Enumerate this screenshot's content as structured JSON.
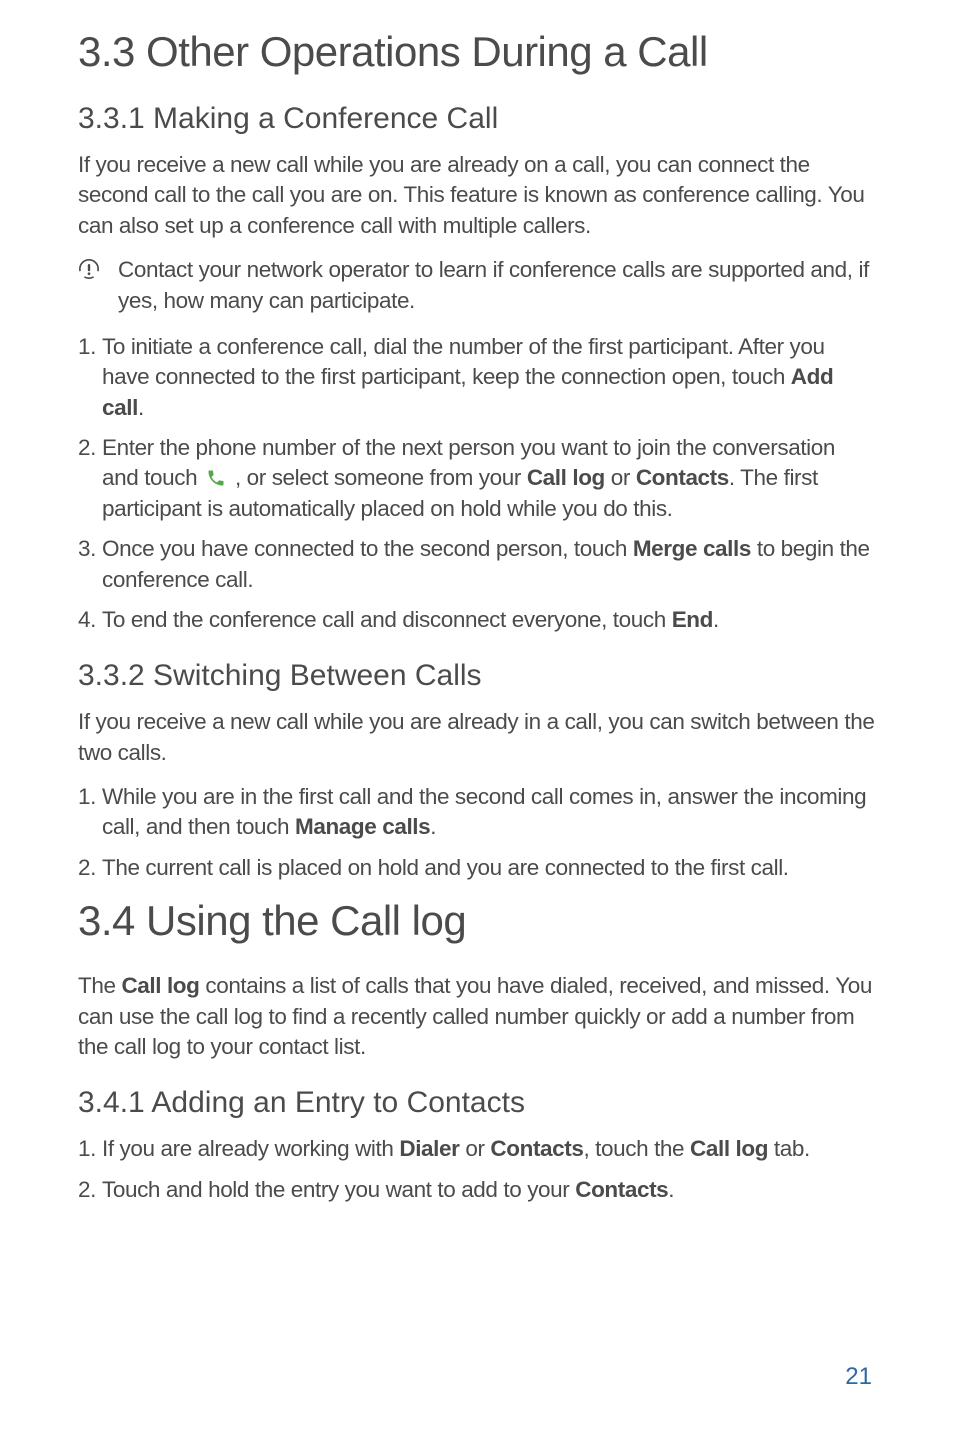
{
  "section33": {
    "title": "3.3  Other Operations During a Call",
    "sub1": {
      "title": "3.3.1  Making a Conference Call",
      "intro": "If you receive a new call while you are already on a call, you can connect the second call to the call you are on. This feature is known as conference calling. You can also set up a conference call with multiple callers.",
      "note": "Contact your network operator to learn if conference calls are supported and, if yes, how many can participate.",
      "steps": {
        "s1a": "To initiate a conference call, dial the number of the first participant. After you have connected to the first participant, keep the connection open, touch ",
        "s1b": "Add call",
        "s1c": ".",
        "s2a": "Enter the phone number of the next person you want to join the conversation and touch ",
        "s2b": " , or select someone from your ",
        "s2c": "Call log",
        "s2d": " or ",
        "s2e": "Contacts",
        "s2f": ". The first participant is automatically placed on hold while you do this.",
        "s3a": "Once you have connected to the second person, touch ",
        "s3b": "Merge calls",
        "s3c": " to begin the conference call.",
        "s4a": "To end the conference call and disconnect everyone, touch ",
        "s4b": "End",
        "s4c": "."
      }
    },
    "sub2": {
      "title": "3.3.2  Switching Between Calls",
      "intro": "If you receive a new call while you are already in a call, you can switch between the two calls.",
      "steps": {
        "s1a": "While you are in the first call and the second call comes in, answer the incoming call, and then touch ",
        "s1b": "Manage calls",
        "s1c": ".",
        "s2": "The current call is placed on hold and you are connected to the first call."
      }
    }
  },
  "section34": {
    "title": "3.4  Using the Call log",
    "intro_a": "The ",
    "intro_b": "Call log",
    "intro_c": " contains a list of calls that you have dialed, received, and missed. You can use the call log to find a recently called number quickly or add a number from the call log to your contact list.",
    "sub1": {
      "title": "3.4.1  Adding an Entry to Contacts",
      "steps": {
        "s1a": "If you are already working with ",
        "s1b": "Dialer",
        "s1c": " or ",
        "s1d": "Contacts",
        "s1e": ", touch the ",
        "s1f": "Call log",
        "s1g": " tab.",
        "s2a": "Touch and hold the entry you want to add to your ",
        "s2b": "Contacts",
        "s2c": "."
      }
    }
  },
  "page_number": "21"
}
